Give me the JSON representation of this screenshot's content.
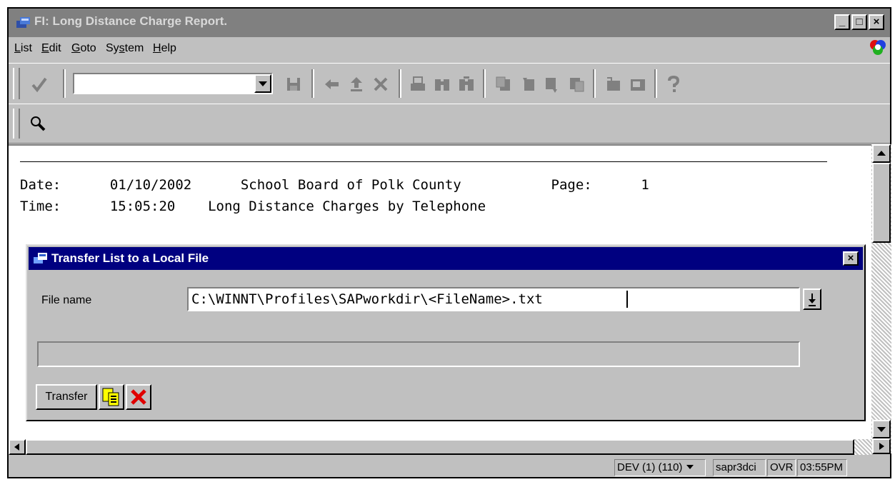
{
  "window": {
    "title": "FI: Long Distance Charge Report.",
    "controls": [
      "_",
      "□",
      "×"
    ]
  },
  "menu": [
    {
      "label": "List",
      "accel": "L",
      "rest": "ist"
    },
    {
      "label": "Edit",
      "accel": "E",
      "rest": "dit"
    },
    {
      "label": "Goto",
      "accel": "G",
      "rest": "oto"
    },
    {
      "label": "System",
      "accel": "S",
      "rest": "y",
      "accel2": "s",
      "rest2": "tem"
    },
    {
      "label": "Help",
      "accel": "H",
      "rest": "elp"
    }
  ],
  "toolbar": {
    "command_field_value": "",
    "icons": [
      "enter-check-icon",
      "command-dropdown-icon",
      "save-icon",
      "back-icon",
      "exit-icon",
      "cancel-icon",
      "print-icon",
      "find-icon",
      "find-next-icon",
      "first-page-icon",
      "previous-page-icon",
      "next-page-icon",
      "last-page-icon",
      "create-session-icon",
      "shortcut-icon",
      "help-icon"
    ]
  },
  "app_toolbar": {
    "icons": [
      "search-icon"
    ]
  },
  "report": {
    "line1": "Date:      01/10/2002      School Board of Polk County           Page:      1",
    "line2": "Time:      15:05:20    Long Distance Charges by Telephone"
  },
  "dialog": {
    "title": "Transfer List to a Local File",
    "file_label": "File name",
    "file_value": "C:\\WINNT\\Profiles\\SAPworkdir\\<FileName>.txt",
    "progress_text": "",
    "transfer_label": "Transfer",
    "close": "×"
  },
  "status": {
    "system": "DEV (1) (110)",
    "server": "sapr3dci",
    "mode": "OVR",
    "time": "03:55PM"
  }
}
